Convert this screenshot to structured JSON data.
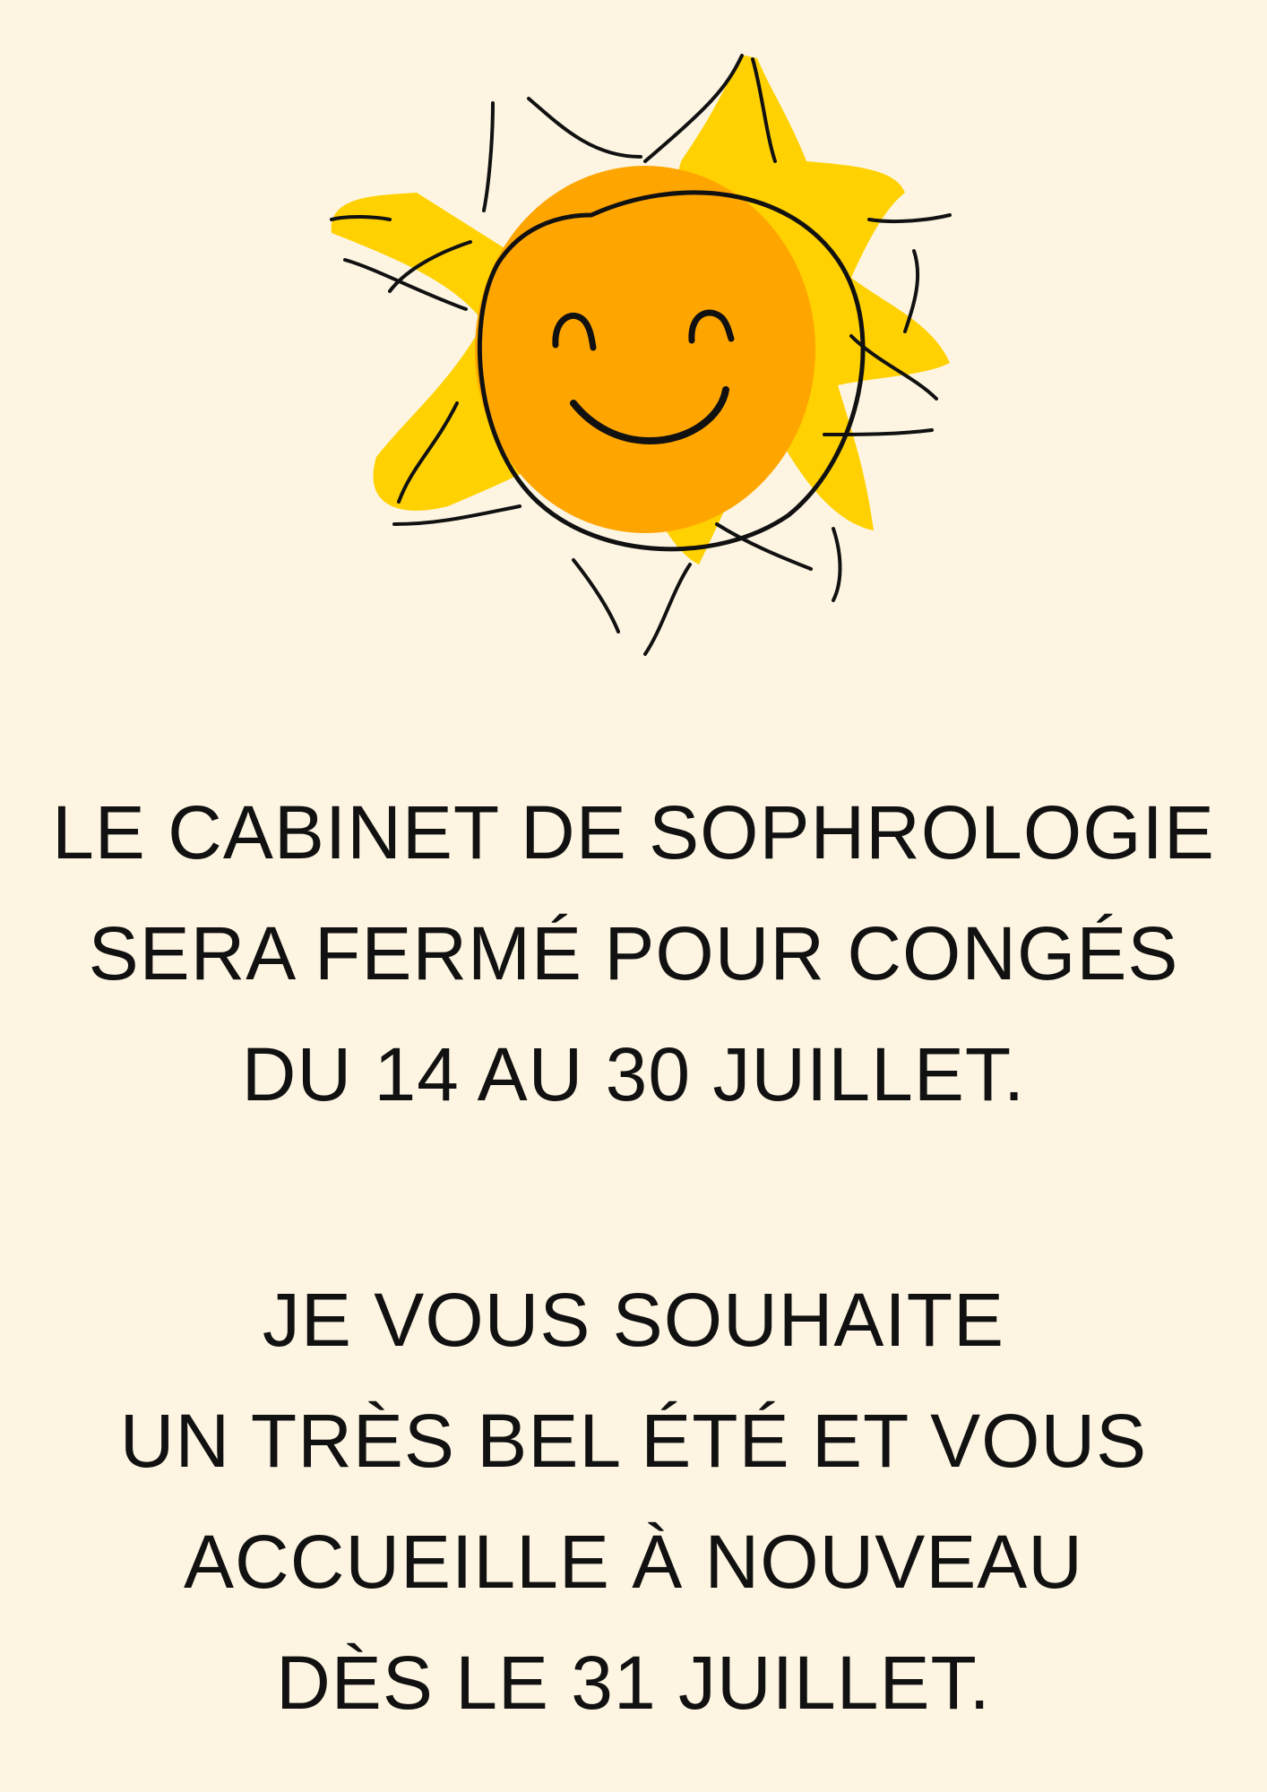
{
  "background_color": "#FDF5E2",
  "illustration": {
    "icon": "smiling-sun-icon",
    "ray_color": "#FFD100",
    "face_color": "#FFA500",
    "outline_color": "#111111"
  },
  "notice": {
    "closure_lines": [
      "LE CABINET DE SOPHROLOGIE",
      "SERA FERMÉ POUR CONGÉS",
      "DU 14 AU 30 JUILLET."
    ],
    "greeting_lines": [
      "JE VOUS SOUHAITE",
      "UN TRÈS BEL ÉTÉ ET VOUS",
      "ACCUEILLE À NOUVEAU",
      "DÈS LE 31 JUILLET."
    ]
  }
}
